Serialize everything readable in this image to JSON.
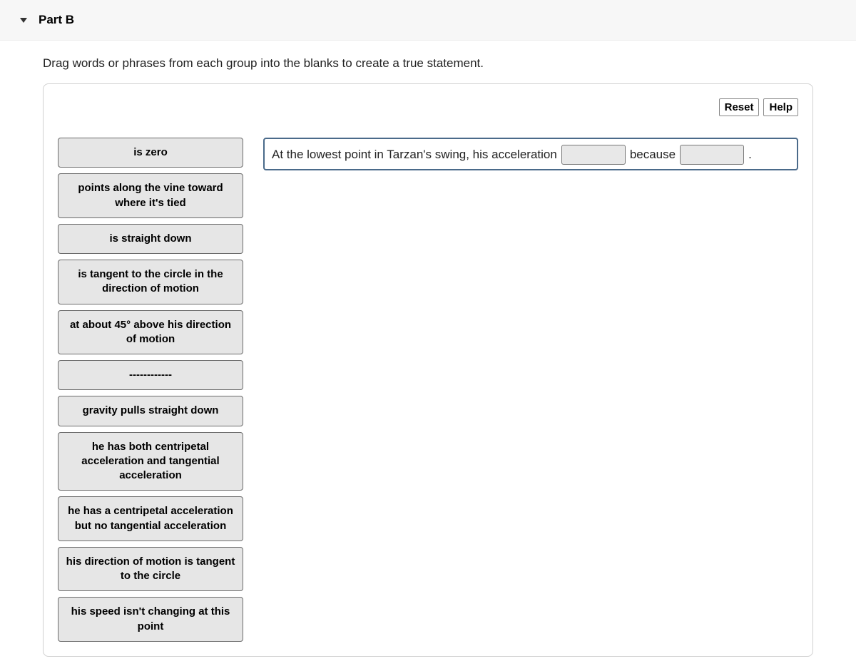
{
  "header": {
    "title": "Part B"
  },
  "instructions": "Drag words or phrases from each group into the blanks to create a true statement.",
  "controls": {
    "reset": "Reset",
    "help": "Help"
  },
  "tiles": [
    "is zero",
    "points along the vine toward where it's tied",
    "is straight down",
    "is tangent to the circle in the direction of motion",
    "at about 45° above his direction of motion",
    "------------",
    "gravity pulls straight down",
    "he has both centripetal acceleration and tangential acceleration",
    "he has a centripetal acceleration but no tangential acceleration",
    "his direction of motion is tangent to the circle",
    "his speed isn't changing at this point"
  ],
  "sentence": {
    "part1": "At the lowest point in Tarzan's swing, his acceleration",
    "connector": "because",
    "end": "."
  }
}
